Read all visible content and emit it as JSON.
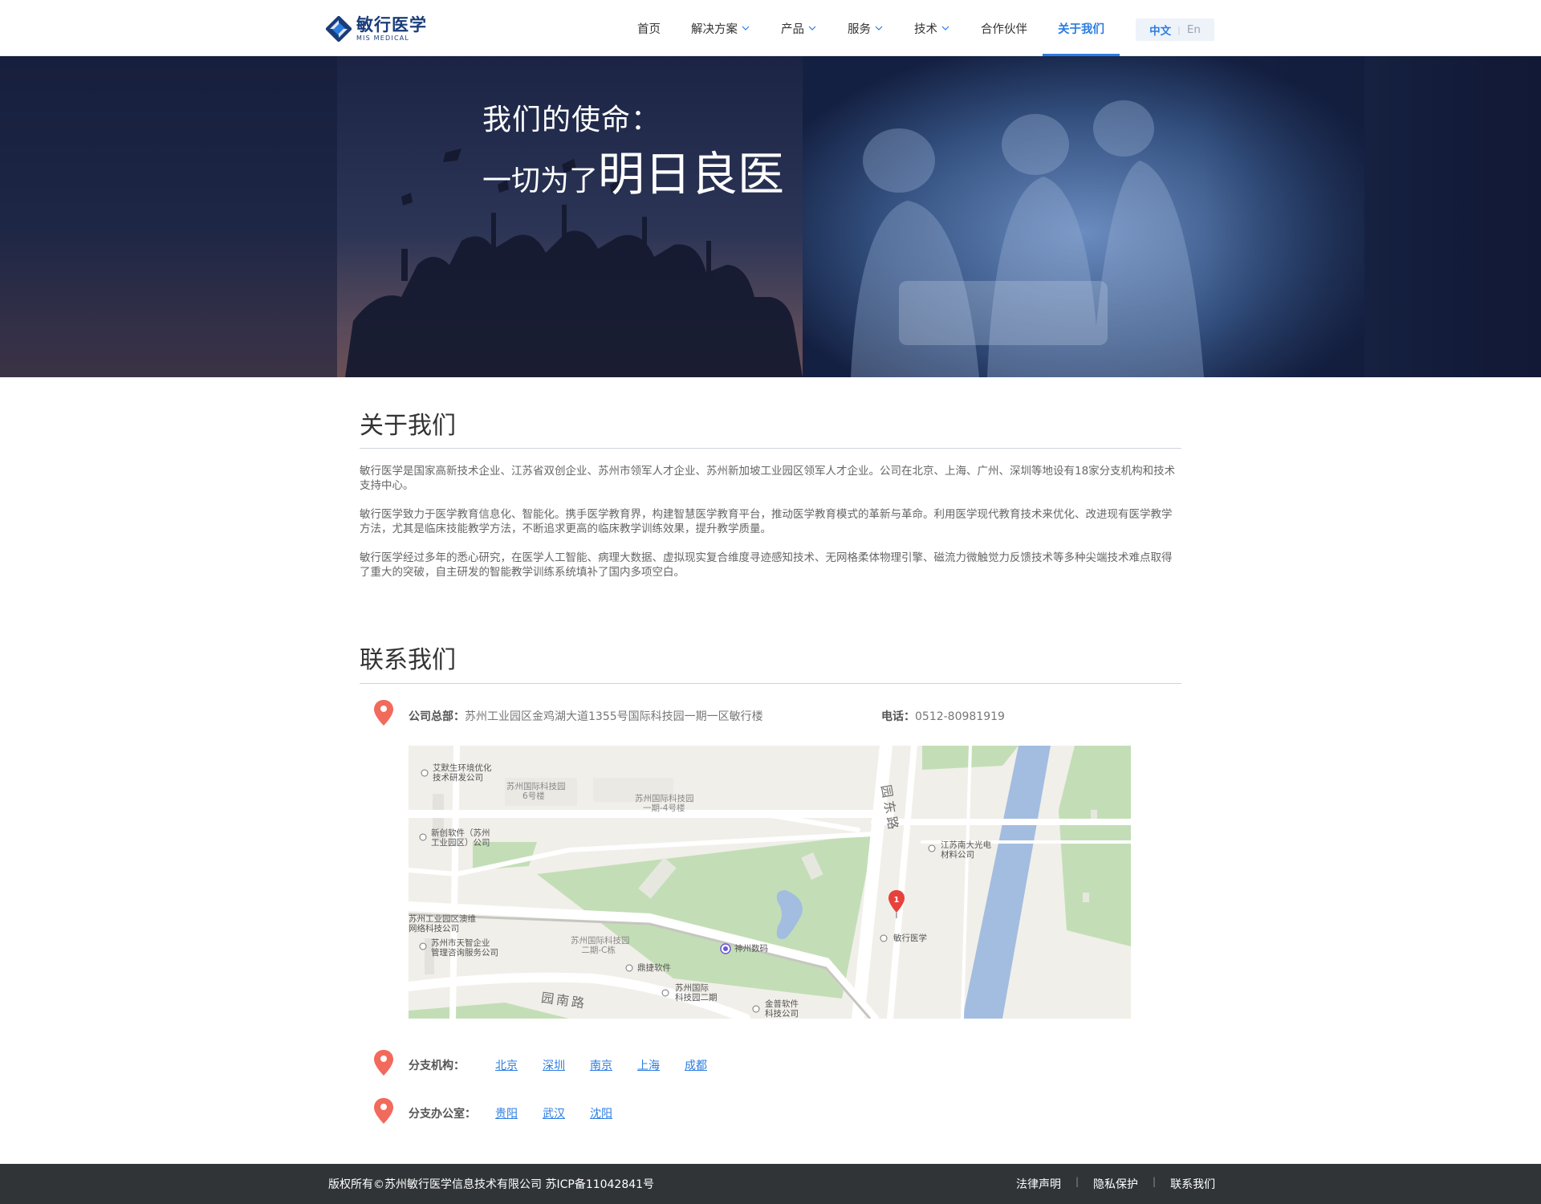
{
  "header": {
    "logo_cn": "敏行医学",
    "logo_en": "MIS MEDICAL",
    "nav": [
      {
        "label": "首页",
        "dropdown": false
      },
      {
        "label": "解决方案",
        "dropdown": true
      },
      {
        "label": "产品",
        "dropdown": true
      },
      {
        "label": "服务",
        "dropdown": true
      },
      {
        "label": "技术",
        "dropdown": true
      },
      {
        "label": "合作伙伴",
        "dropdown": false
      },
      {
        "label": "关于我们",
        "dropdown": false,
        "active": true
      }
    ],
    "lang": {
      "zh": "中文",
      "sep": "|",
      "en": "En"
    },
    "accent_color": "#2b7ce2"
  },
  "hero": {
    "line1": "我们的使命：",
    "line2_small": "一切为了",
    "line2_big": "明日良医"
  },
  "about": {
    "title": "关于我们",
    "paragraphs": [
      "敏行医学是国家高新技术企业、江苏省双创企业、苏州市领军人才企业、苏州新加坡工业园区领军人才企业。公司在北京、上海、广州、深圳等地设有18家分支机构和技术支持中心。",
      "敏行医学致力于医学教育信息化、智能化。携手医学教育界，构建智慧医学教育平台，推动医学教育模式的革新与革命。利用医学现代教育技术来优化、改进现有医学教学方法，尤其是临床技能教学方法，不断追求更高的临床教学训练效果，提升教学质量。",
      "敏行医学经过多年的悉心研究，在医学人工智能、病理大数据、虚拟现实复合维度寻迹感知技术、无网格柔体物理引擎、磁流力微触觉力反馈技术等多种尖端技术难点取得了重大的突破，自主研发的智能教学训练系统填补了国内多项空白。"
    ]
  },
  "contact": {
    "title": "联系我们",
    "hq_key": "公司总部：",
    "hq_value": "苏州工业园区金鸡湖大道1355号国际科技园一期一区敏行楼",
    "phone_key": "电话：",
    "phone_value": "0512-80981919",
    "pin_color": "#f26a5c",
    "map": {
      "labels": [
        "艾默生环境优化\n技术研发公司",
        "苏州国际科技园\n6号楼",
        "苏州国际科技园\n一期-4号楼",
        "新创软件（苏州\n工业园区）公司",
        "江苏南大光电\n材料公司",
        "苏州工业园区澳维\n网络科技公司",
        "苏州市天智企业\n管理咨询服务公司",
        "苏州国际科技园\n二期-C栋",
        "神州数码",
        "敏行医学",
        "鼎捷软件",
        "苏州国际\n科技园二期",
        "金普软件\n科技公司",
        "园东路",
        "园南路"
      ],
      "marker": "1"
    },
    "branches_key": "分支机构：",
    "branches": [
      "北京",
      "深圳",
      "南京",
      "上海",
      "成都"
    ],
    "offices_key": "分支办公室：",
    "offices": [
      "贵阳",
      "武汉",
      "沈阳"
    ]
  },
  "footer": {
    "copyright": "版权所有©苏州敏行医学信息技术有限公司  苏ICP备11042841号",
    "links": [
      "法律声明",
      "隐私保护",
      "联系我们"
    ]
  }
}
